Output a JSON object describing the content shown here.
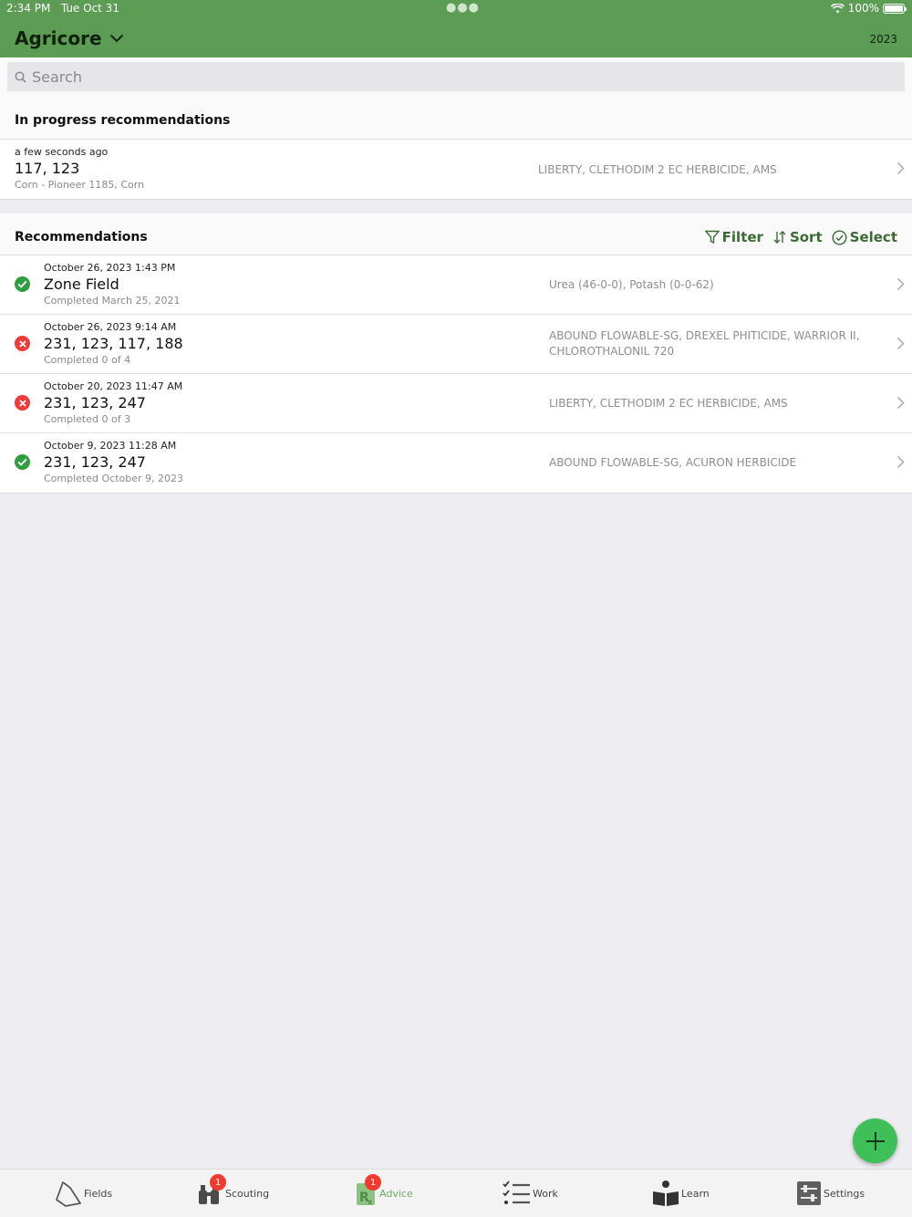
{
  "status_bar": {
    "time": "2:34 PM",
    "date": "Tue Oct 31",
    "battery": "100%",
    "battery_level": 1.0
  },
  "header": {
    "app_name": "Agricore",
    "year": "2023"
  },
  "search": {
    "placeholder": "Search"
  },
  "in_progress": {
    "title": "In progress recommendations",
    "items": [
      {
        "time": "a few seconds ago",
        "name": "117, 123",
        "crop": "Corn - Pioneer 1185, Corn",
        "products": "LIBERTY, CLETHODIM 2 EC HERBICIDE, AMS"
      }
    ]
  },
  "recommendations": {
    "title": "Recommendations",
    "filter_label": "Filter",
    "sort_label": "Sort",
    "select_label": "Select",
    "items": [
      {
        "status": "complete",
        "date": "October 26, 2023 1:43 PM",
        "name": "Zone Field",
        "completion": "Completed March 25, 2021",
        "products": "Urea (46-0-0), Potash (0-0-62)"
      },
      {
        "status": "incomplete",
        "date": "October 26, 2023 9:14 AM",
        "name": "231, 123, 117, 188",
        "completion": "Completed 0 of 4",
        "products": "ABOUND FLOWABLE-SG, DREXEL PHITICIDE, WARRIOR II, CHLOROTHALONIL 720"
      },
      {
        "status": "incomplete",
        "date": "October 20, 2023 11:47 AM",
        "name": "231, 123, 247",
        "completion": "Completed 0 of 3",
        "products": "LIBERTY, CLETHODIM 2 EC HERBICIDE, AMS"
      },
      {
        "status": "complete",
        "date": "October 9, 2023 11:28 AM",
        "name": "231, 123, 247",
        "completion": "Completed October 9, 2023",
        "products": "ABOUND FLOWABLE-SG, ACURON HERBICIDE"
      }
    ]
  },
  "tabs": [
    {
      "label": "Fields",
      "icon": "fields-icon"
    },
    {
      "label": "Scouting",
      "icon": "binoculars-icon",
      "badge": "1"
    },
    {
      "label": "Advice",
      "icon": "rx-icon",
      "badge": "1",
      "active": true
    },
    {
      "label": "Work",
      "icon": "checklist-icon"
    },
    {
      "label": "Learn",
      "icon": "book-icon"
    },
    {
      "label": "Settings",
      "icon": "settings-icon"
    }
  ],
  "colors": {
    "header": "#5c9c54",
    "accent": "#3b6b34",
    "fab": "#3fbf58",
    "complete": "#2e9e3e",
    "incomplete": "#ef3b3b",
    "badge": "#f23b30"
  }
}
